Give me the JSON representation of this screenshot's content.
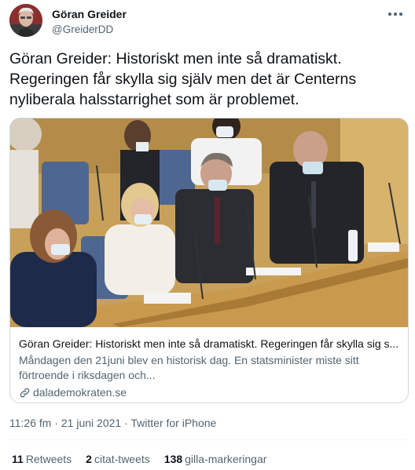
{
  "author": {
    "display_name": "Göran Greider",
    "handle": "@GreiderDD"
  },
  "tweet": {
    "text": "Göran Greider: Historiskt men inte så dramatiskt.\nRegeringen får skylla sig själv men det är Centerns\nnyliberala halsstarrighet som är problemet."
  },
  "card": {
    "image_icon": "parliament-photo",
    "title": "Göran Greider: Historiskt men inte så dramatiskt. Regeringen får skylla sig s...",
    "description": "Måndagen den 21juni blev en historisk dag. En statsminister miste sitt förtroende i riksdagen och...",
    "domain": "dalademokraten.se"
  },
  "meta": {
    "time": "11:26 fm",
    "separator1": " · ",
    "date": "21 juni 2021",
    "separator2": " · ",
    "source": "Twitter for iPhone"
  },
  "stats": {
    "retweets_count": "11",
    "retweets_label": "Retweets",
    "quotes_count": "2",
    "quotes_label": "citat-tweets",
    "likes_count": "138",
    "likes_label": "gilla-markeringar"
  },
  "colors": {
    "text": "#0f1419",
    "secondary": "#536471",
    "border": "#cfd9de"
  }
}
